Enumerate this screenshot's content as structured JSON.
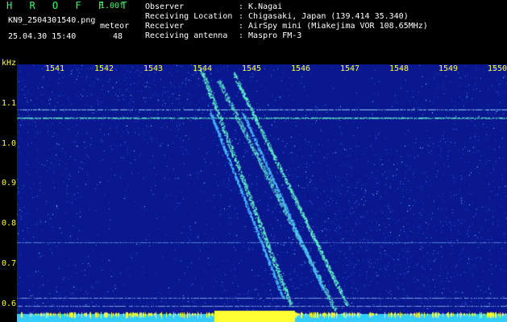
{
  "header": {
    "app_name": "H R O F F T",
    "version": "1.00f",
    "filename": "KN9_2504301540.png",
    "mode_label": "meteor",
    "datetime": "25.04.30 15:40",
    "count": "48"
  },
  "info": [
    {
      "label": "Observer",
      "value": ": K.Nagai"
    },
    {
      "label": "Receiving Location",
      "value": ": Chigasaki, Japan (139.414 35.340)"
    },
    {
      "label": "Receiver",
      "value": ": AirSpy mini (Miakejima VOR 108.65MHz)"
    },
    {
      "label": "Receiving antenna",
      "value": ": Maspro FM-3"
    }
  ],
  "axes": {
    "y_unit": "kHz",
    "y_ticks": [
      "1.1",
      "1.0",
      "0.9",
      "0.8",
      "0.7",
      "0.6"
    ],
    "x_ticks": [
      "1541",
      "1542",
      "1543",
      "1544",
      "1545",
      "1546",
      "1547",
      "1548",
      "1549",
      "1550"
    ]
  },
  "colors": {
    "background": "#000000",
    "plot_bg": "#0a1890",
    "noise": "#3c7cff",
    "signal": "#66ffcc",
    "bottom_band": "#33ccff",
    "bottom_yellow": "#ffff33",
    "label_green": "#33ff66",
    "label_yellow": "#ffff33"
  }
}
